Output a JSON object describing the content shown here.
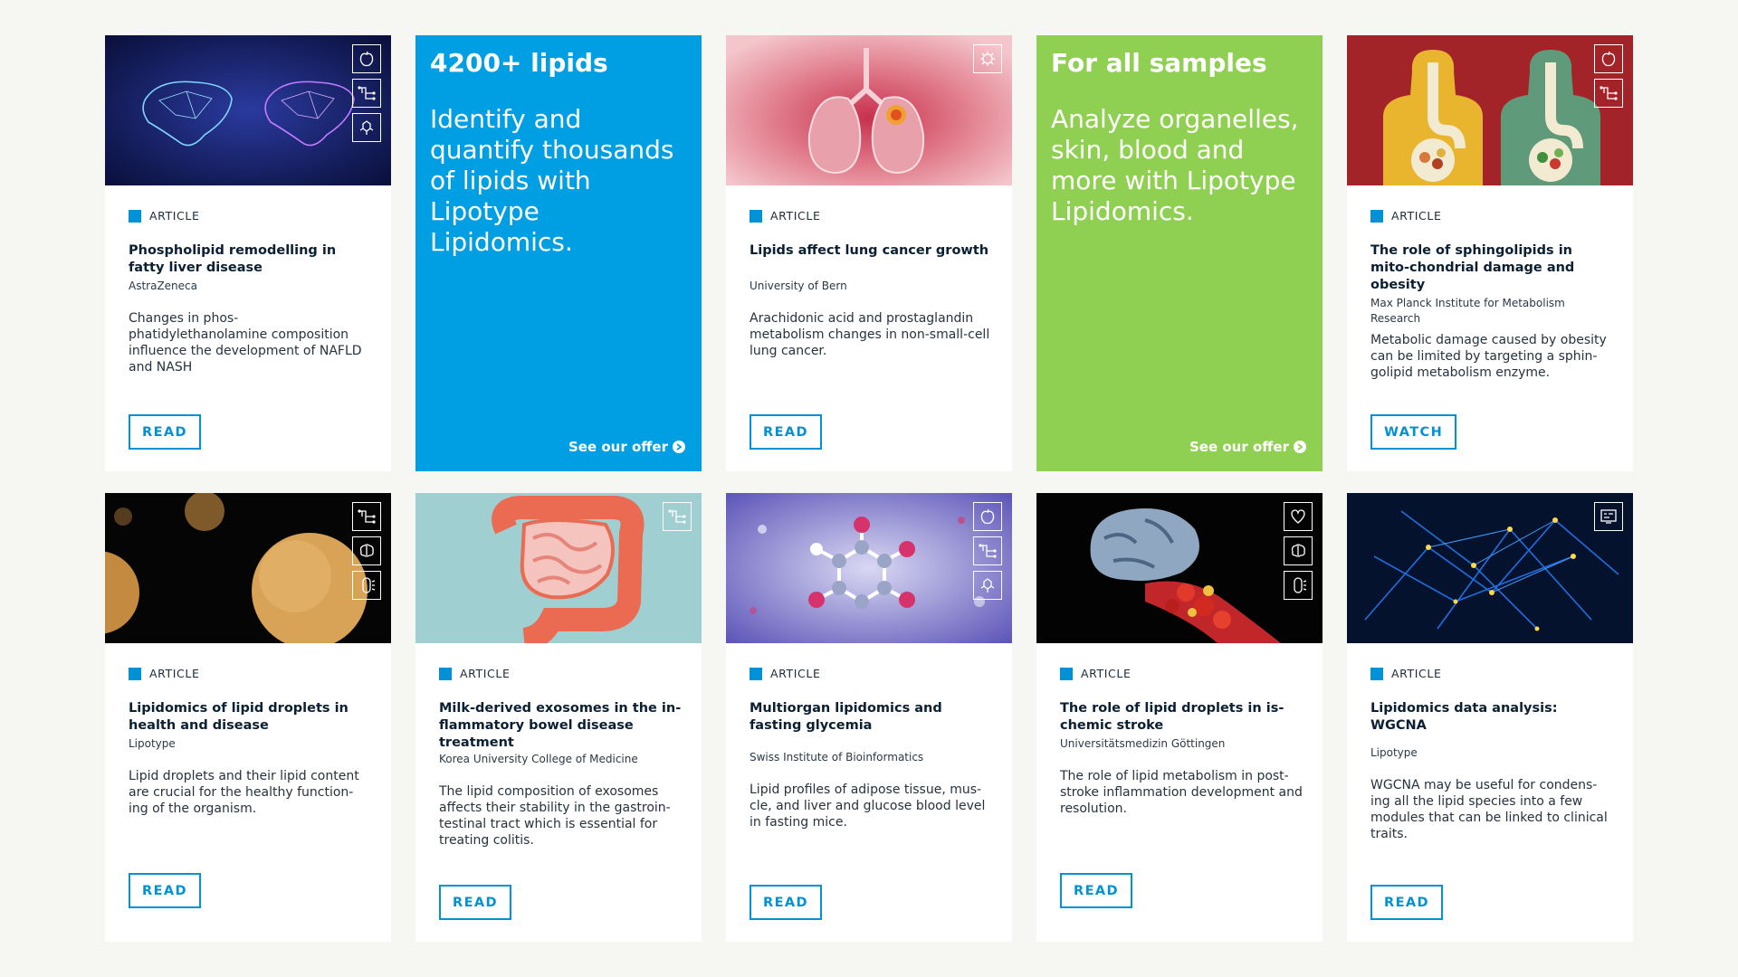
{
  "cards_row1": [
    {
      "kind": "article",
      "tag": "ARTICLE",
      "title": "Phospholipid remodelling in fatty liver disease",
      "org": "AstraZeneca",
      "desc": "Changes in phos-phatidylethanolamine composition influence the development of NAFLD and NASH",
      "button": "READ",
      "image": "liver-illustration",
      "icons": [
        "apple-icon",
        "pathway-icon",
        "molecule-icon"
      ]
    },
    {
      "kind": "promo",
      "headline": "4200+ lipids",
      "text": "Identify and quantify thousands of lipids with Lipotype Lipidomics.",
      "link": "See our offer",
      "color": "#009fe3"
    },
    {
      "kind": "article",
      "tag": "ARTICLE",
      "title": "Lipids affect lung cancer growth",
      "org": "University of Bern",
      "desc": "Arachidonic acid and prostaglandin metabolism changes in non-small-cell lung cancer.",
      "button": "READ",
      "image": "lungs-illustration",
      "icons": [
        "virus-icon"
      ]
    },
    {
      "kind": "promo",
      "headline": "For all samples",
      "text": "Analyze organelles, skin, blood and more with Lipotype Lipidomics.",
      "link": "See our offer",
      "color": "#8fd052"
    },
    {
      "kind": "article",
      "tag": "ARTICLE",
      "title": "The role of sphingolipids in mito-chondrial damage and obesity",
      "org": "Max Planck Institute for Metabolism Research",
      "desc": "Metabolic damage caused by obesity can be limited by targeting a sphin-golipid metabolism enzyme.",
      "button": "WATCH",
      "image": "body-digestion-illustration",
      "icons": [
        "apple-icon",
        "pathway-icon"
      ]
    }
  ],
  "cards_row2": [
    {
      "kind": "article",
      "tag": "ARTICLE",
      "title": "Lipidomics of lipid droplets in health and disease",
      "org": "Lipotype",
      "desc": "Lipid droplets and their lipid content are crucial for the healthy function-ing of the organism.",
      "button": "READ",
      "image": "lipid-droplets-illustration",
      "icons": [
        "pathway-icon",
        "brain-icon",
        "cell-icon"
      ]
    },
    {
      "kind": "article",
      "tag": "ARTICLE",
      "title": "Milk-derived exosomes in the in-flammatory bowel disease treatment",
      "org": "Korea University College of Medicine",
      "desc": "The lipid composition of exosomes affects their stability in the gastroin-testinal tract which is essential for treating colitis.",
      "button": "READ",
      "image": "intestine-illustration",
      "icons": [
        "pathway-icon"
      ]
    },
    {
      "kind": "article",
      "tag": "ARTICLE",
      "title": "Multiorgan lipidomics and fasting glycemia",
      "org": "Swiss Institute of Bioinformatics",
      "desc": "Lipid profiles of adipose tissue, mus-cle, and liver and glucose blood level in fasting mice.",
      "button": "READ",
      "image": "molecule-illustration",
      "icons": [
        "apple-icon",
        "pathway-icon",
        "molecule-icon"
      ]
    },
    {
      "kind": "article",
      "tag": "ARTICLE",
      "title": "The role of lipid droplets in is-chemic stroke",
      "org": "Universitätsmedizin Göttingen",
      "desc": "The role of lipid metabolism in post-stroke inflammation development and resolution.",
      "button": "READ",
      "image": "brain-stroke-illustration",
      "icons": [
        "heart-icon",
        "brain-icon",
        "cell-icon"
      ]
    },
    {
      "kind": "article",
      "tag": "ARTICLE",
      "title": "Lipidomics data analysis: WGCNA",
      "org": "Lipotype",
      "desc": "WGCNA may be useful for condens-ing all the lipid species into a few modules that can be linked to clinical traits.",
      "button": "READ",
      "image": "network-illustration",
      "icons": [
        "data-icon"
      ]
    }
  ],
  "colors": {
    "accent": "#0091d6",
    "promo_blue": "#009fe3",
    "promo_green": "#8fd052",
    "tag_square": "#0091d6"
  }
}
